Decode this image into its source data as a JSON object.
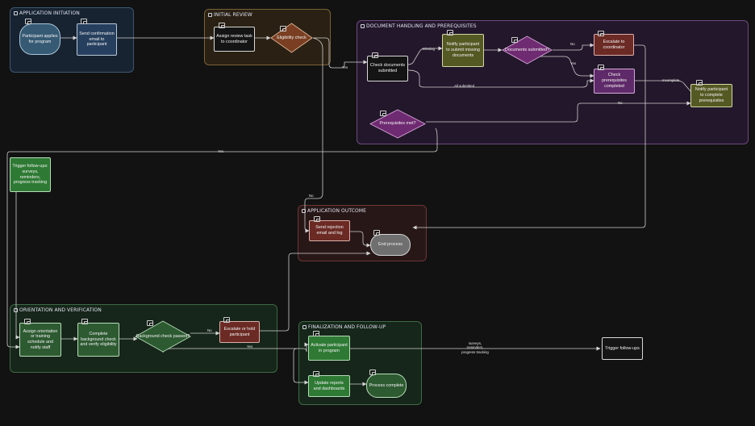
{
  "groups": {
    "application_initiation": "APPLICATION INITIATION",
    "initial_review": "INITIAL REVIEW",
    "document_handling": "DOCUMENT HANDLING AND PREREQUISITES",
    "application_outcome": "APPLICATION OUTCOME",
    "orientation": "ORIENTATION AND VERIFICATION",
    "finalization": "FINALIZATION AND FOLLOW-UP"
  },
  "nodes": {
    "participant_applies": "Participant applies for program",
    "send_confirmation": "Send confirmation email to participant",
    "assign_review": "Assign review task to coordinator",
    "eligibility_check": "Eligibility check",
    "check_documents": "Check documents submitted",
    "notify_missing": "Notify participant to submit missing documents",
    "documents_submitted": "Documents submitted?",
    "escalate_coordinator": "Escalate to coordinator",
    "check_prerequisites": "Check prerequisites completed",
    "notify_prerequisites": "Notify participant to complete prerequisites",
    "prerequisites_met": "Prerequisites met?",
    "trigger_followups_left": "Trigger follow-ups: surveys, reminders, progress tracking",
    "send_rejection": "Send rejection email and log",
    "end_process": "End process",
    "assign_orientation": "Assign orientation or training schedule and notify staff",
    "complete_background": "Complete background check and verify eligibility",
    "background_passed": "Background check passed?",
    "escalate_hold": "Escalate or hold participant",
    "activate_participant": "Activate participant in program",
    "update_reports": "Update reports and dashboards",
    "process_complete": "Process complete",
    "trigger_followups_right": "Trigger follow-ups"
  },
  "edge_labels": {
    "yes_eligible": "Yes",
    "missing": "Missing",
    "all_submitted": "All submitted",
    "no_docs": "No",
    "yes_docs": "Yes",
    "incomplete": "Incomplete",
    "no_prereq": "No",
    "yes_prereq": "Yes",
    "no_eligible": "No",
    "no_background": "No",
    "yes_background": "Yes",
    "followup_channels": "surveys, reminders, progress tracking"
  },
  "colors": {
    "background": "#121212",
    "blue_group": "#172331",
    "orange_group": "#2a2114",
    "purple_group": "#23172b",
    "red_group": "#281717",
    "green_group": "#16261a",
    "edge": "#d6d6d6"
  }
}
